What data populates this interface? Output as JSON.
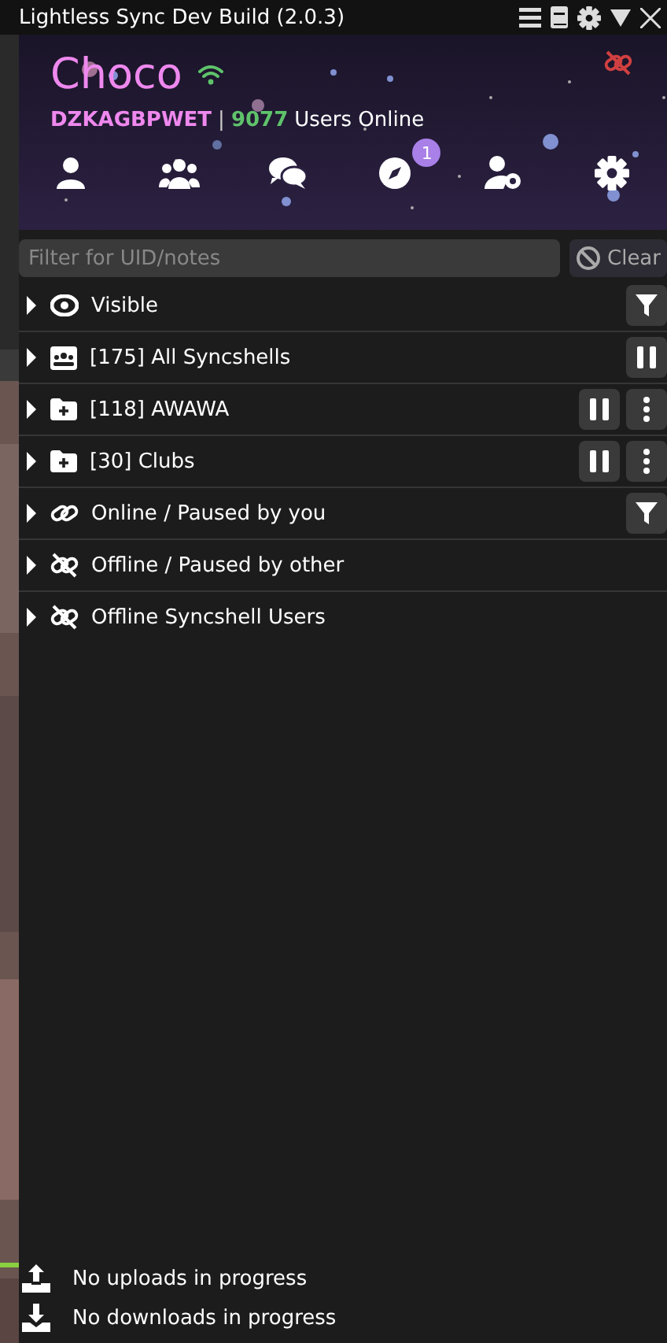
{
  "window": {
    "title": "Lightless Sync Dev Build (2.0.3)"
  },
  "header": {
    "name": "Choco",
    "uid": "DZKAGBPWET",
    "separator": "|",
    "online_count": "9077",
    "online_label": "Users Online"
  },
  "nav": [
    {
      "kind": "user"
    },
    {
      "kind": "users"
    },
    {
      "kind": "chat"
    },
    {
      "kind": "compass",
      "badge": "1"
    },
    {
      "kind": "usergear"
    },
    {
      "kind": "gear"
    }
  ],
  "filter": {
    "placeholder": "Filter for UID/notes",
    "clear": "Clear"
  },
  "groups": [
    {
      "kind": "eye",
      "label": "Visible",
      "expanded": false,
      "actions": [
        {
          "kind": "filter"
        }
      ]
    },
    {
      "kind": "syncshells",
      "label": "[175] All Syncshells",
      "expanded": false,
      "actions": [
        {
          "kind": "pause"
        }
      ]
    },
    {
      "kind": "folder",
      "label": "[118] AWAWA",
      "expanded": false,
      "actions": [
        {
          "kind": "pause"
        },
        {
          "kind": "menu"
        }
      ]
    },
    {
      "kind": "folder",
      "label": "[30] Clubs",
      "expanded": false,
      "actions": [
        {
          "kind": "pause"
        },
        {
          "kind": "menu"
        }
      ]
    },
    {
      "kind": "link",
      "label": "Online / Paused by you",
      "expanded": false,
      "actions": [
        {
          "kind": "filter"
        }
      ]
    },
    {
      "kind": "unlink",
      "label": "Offline / Paused by other",
      "expanded": false
    },
    {
      "kind": "unlink",
      "label": "Offline Syncshell Users",
      "expanded": false
    }
  ],
  "transfers": [
    {
      "kind": "upload",
      "text": "No uploads in progress"
    },
    {
      "kind": "download",
      "text": "No downloads in progress"
    }
  ]
}
